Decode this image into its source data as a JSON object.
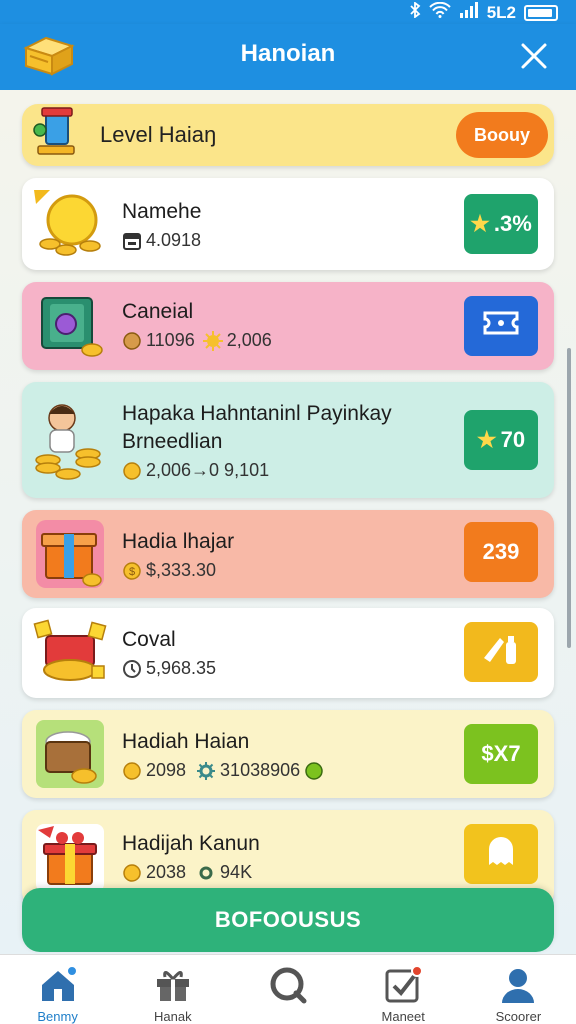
{
  "status_bar": {
    "battery": "5L2"
  },
  "header": {
    "title": "Hanoian"
  },
  "level_banner": {
    "label": "Level Haiaŋ",
    "button": "Boouy"
  },
  "rewards": [
    {
      "title": "Namehe",
      "line2": "",
      "meta1": "4.0918",
      "meta2": "",
      "badge": ".3%",
      "bg": "#ffffff",
      "badge_color": "#1fa36c"
    },
    {
      "title": "Caneial",
      "line2": "",
      "meta1": "11096",
      "meta2": "2,006",
      "badge": "",
      "bg": "#f6b3c8",
      "badge_color": "#2469d8"
    },
    {
      "title": "Hapaka Hahntaninl Payinkay",
      "line2": "Brneedlian",
      "meta1": "2,006→0 9,101",
      "meta2": "",
      "badge": "70",
      "bg": "#cdeee6",
      "badge_color": "#1fa36c"
    },
    {
      "title": "Hadia lhajar",
      "line2": "",
      "meta1": "$,333.30",
      "meta2": "",
      "badge": "239",
      "bg": "#f8b9a7",
      "badge_color": "#f27b1d"
    },
    {
      "title": "Coval",
      "line2": "",
      "meta1": "5,968.35",
      "meta2": "",
      "badge": "",
      "bg": "#ffffff",
      "badge_color": "#f2b91d"
    },
    {
      "title": "Hadiah Haian",
      "line2": "",
      "meta1": "2098",
      "meta2": "31038906",
      "badge": "$X7",
      "bg": "#fbf3c8",
      "badge_color": "#7cc21f"
    },
    {
      "title": "Hadijah Kanun",
      "line2": "",
      "meta1": "2038",
      "meta2": "94K",
      "badge": "",
      "bg": "#fbf3c8",
      "badge_color": "#f2c31d"
    }
  ],
  "claim_button": "BOFOOUSUS",
  "nav": [
    {
      "label": "Benmy"
    },
    {
      "label": "Hanak"
    },
    {
      "label": ""
    },
    {
      "label": "Maneet"
    },
    {
      "label": "Scoorer"
    }
  ],
  "colors": {
    "primary": "#1e8fe1",
    "accent": "#f27b1d",
    "claim": "#2eb27a"
  }
}
